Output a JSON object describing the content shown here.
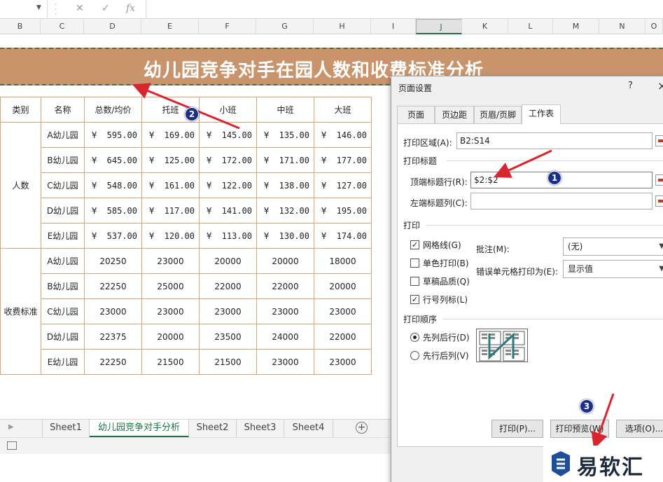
{
  "formula_bar": {
    "fx_label": "fx"
  },
  "columns": [
    "B",
    "C",
    "D",
    "E",
    "F",
    "G",
    "H",
    "I",
    "J",
    "K",
    "L",
    "M",
    "N",
    "O"
  ],
  "selected_column": "J",
  "title": "幼儿园竞争对手在园人数和收费标准分析",
  "table": {
    "headers": [
      "类别",
      "名称",
      "总数/均价",
      "托班",
      "小班",
      "中班",
      "大班"
    ],
    "group1": {
      "label": "人数",
      "rows": [
        {
          "name": "A幼儿园",
          "vals": [
            "595.00",
            "169.00",
            "145.00",
            "135.00",
            "146.00"
          ]
        },
        {
          "name": "B幼儿园",
          "vals": [
            "645.00",
            "125.00",
            "172.00",
            "171.00",
            "177.00"
          ]
        },
        {
          "name": "C幼儿园",
          "vals": [
            "548.00",
            "161.00",
            "122.00",
            "138.00",
            "127.00"
          ]
        },
        {
          "name": "D幼儿园",
          "vals": [
            "585.00",
            "117.00",
            "141.00",
            "132.00",
            "195.00"
          ]
        },
        {
          "name": "E幼儿园",
          "vals": [
            "537.00",
            "120.00",
            "113.00",
            "130.00",
            "174.00"
          ]
        }
      ]
    },
    "group2": {
      "label": "收费标准",
      "rows": [
        {
          "name": "A幼儿园",
          "vals": [
            "20250",
            "23000",
            "20000",
            "20000",
            "18000"
          ]
        },
        {
          "name": "B幼儿园",
          "vals": [
            "22250",
            "25000",
            "22000",
            "22000",
            "20000"
          ]
        },
        {
          "name": "C幼儿园",
          "vals": [
            "23000",
            "23000",
            "23000",
            "23000",
            "23000"
          ]
        },
        {
          "name": "D幼儿园",
          "vals": [
            "22375",
            "20000",
            "23500",
            "24000",
            "22000"
          ]
        },
        {
          "name": "E幼儿园",
          "vals": [
            "22250",
            "21500",
            "21500",
            "23000",
            "23000"
          ]
        }
      ]
    },
    "currency_symbol": "¥"
  },
  "sheet_tabs": [
    "Sheet1",
    "幼儿园竞争对手分析",
    "Sheet2",
    "Sheet3",
    "Sheet4"
  ],
  "active_tab": "幼儿园竞争对手分析",
  "dialog": {
    "title": "页面设置",
    "help": "?",
    "close": "×",
    "tabs": [
      "页面",
      "页边距",
      "页眉/页脚",
      "工作表"
    ],
    "active_tab": "工作表",
    "print_area_label": "打印区域(A):",
    "print_area_value": "B2:S14",
    "print_titles_section": "打印标题",
    "top_rows_label": "顶端标题行(R):",
    "top_rows_value": "$2:$2",
    "left_cols_label": "左端标题列(C):",
    "left_cols_value": "",
    "print_section": "打印",
    "checkboxes": [
      {
        "label": "网格线(G)",
        "checked": true
      },
      {
        "label": "单色打印(B)",
        "checked": false
      },
      {
        "label": "草稿品质(Q)",
        "checked": false
      },
      {
        "label": "行号列标(L)",
        "checked": true
      }
    ],
    "comments_label": "批注(M):",
    "comments_value": "(无)",
    "errors_label": "错误单元格打印为(E):",
    "errors_value": "显示值",
    "order_section": "打印顺序",
    "radios": [
      {
        "label": "先列后行(D)",
        "selected": true
      },
      {
        "label": "先行后列(V)",
        "selected": false
      }
    ],
    "buttons": {
      "print": "打印(P)...",
      "preview": "打印预览(W)",
      "options": "选项(O)..."
    }
  },
  "annotations": [
    "1",
    "2",
    "3"
  ],
  "watermark": "易软汇",
  "colors": {
    "title_band": "#c9946b",
    "arrow": "#d9262e",
    "badge": "#1a2f8a",
    "accent": "#217346"
  }
}
